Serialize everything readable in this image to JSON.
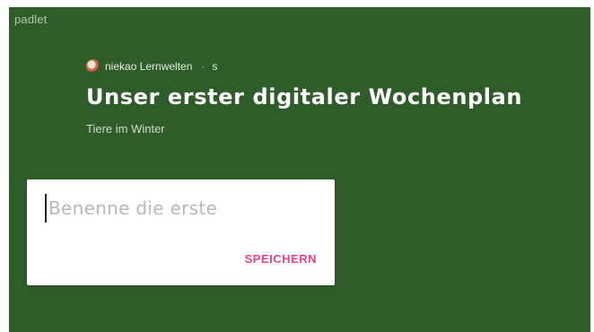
{
  "app": {
    "brand": "padlet"
  },
  "header": {
    "author": "niekao Lernwelten",
    "time": "s",
    "title": "Unser erster digitaler Wochenplan",
    "subtitle": "Tiere im Winter"
  },
  "card": {
    "input_value": "",
    "input_placeholder": "Benenne die erste",
    "save_label": "SPEICHERN"
  },
  "colors": {
    "board_background": "#2f5d2a",
    "accent": "#ee3f8a"
  },
  "icons": {
    "avatar": "author-avatar-icon"
  }
}
